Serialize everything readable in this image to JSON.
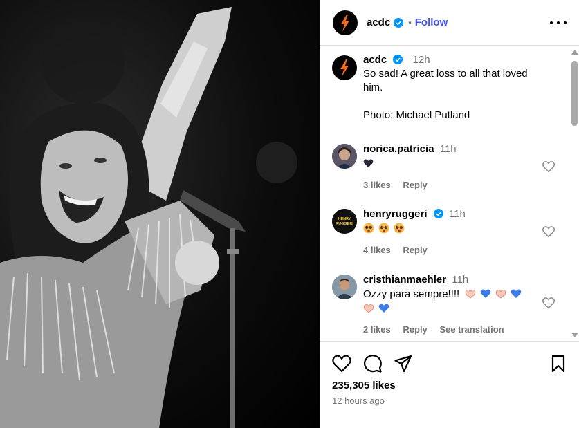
{
  "post": {
    "username": "acdc",
    "follow_label": "Follow",
    "dot": "•",
    "caption": {
      "username": "acdc",
      "time": "12h",
      "line1": "So sad! A great loss to all that loved",
      "line2": "him.",
      "line3": "Photo: Michael Putland"
    },
    "likes": "235,305 likes",
    "posted": "12 hours ago"
  },
  "comments": [
    {
      "username": "norica.patricia",
      "time": "11h",
      "text_emoji": [
        "black-heart"
      ],
      "likes": "3 likes",
      "reply": "Reply",
      "verified": false
    },
    {
      "username": "henryruggeri",
      "time": "11h",
      "text_emoji": [
        "pleading-face",
        "pleading-face",
        "pleading-face"
      ],
      "likes": "4 likes",
      "reply": "Reply",
      "verified": true,
      "avatar_text": "HENRY RUGGERI"
    },
    {
      "username": "cristhianmaehler",
      "time": "11h",
      "text": "Ozzy para sempre!!!!",
      "text_emoji": [
        "heart-hands",
        "blue-heart",
        "heart-hands",
        "blue-heart",
        "heart-hands",
        "blue-heart"
      ],
      "likes": "2 likes",
      "reply": "Reply",
      "see_translation": "See translation",
      "verified": false
    }
  ],
  "colors": {
    "follow": "#4150f7",
    "verified": "#0095f6",
    "muted": "#737373",
    "acdc_bolt": "#f26a1b"
  },
  "icons": [
    "more-options-icon",
    "like-icon",
    "comment-icon",
    "share-icon",
    "save-icon",
    "verified-badge-icon"
  ]
}
